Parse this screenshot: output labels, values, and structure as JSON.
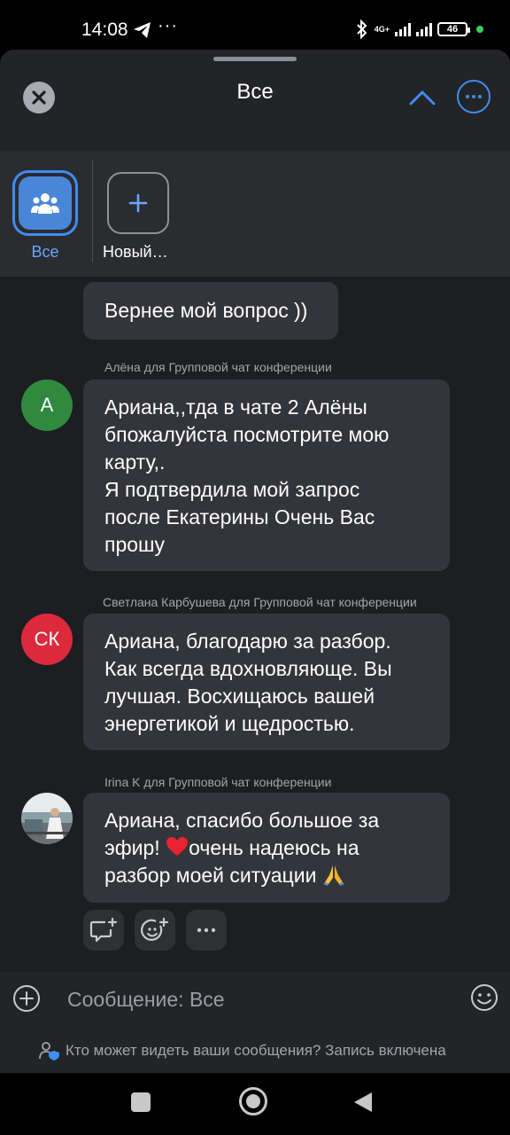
{
  "status_bar": {
    "time": "14:08",
    "dots": "···",
    "network": "4G+",
    "battery": "46"
  },
  "header": {
    "title": "Все"
  },
  "groups": [
    {
      "label": "Все"
    },
    {
      "label": "Новый…"
    }
  ],
  "messages": [
    {
      "text": "Вернее мой вопрос ))"
    },
    {
      "sender": "Алёна для Групповой чат конференции",
      "avatar_initials": "А",
      "avatar_color": "#2f8a3f",
      "lines": [
        "Ариана,,тда в чате 2 Алёны",
        "бпожалуйста посмотрите мою",
        "карту,.",
        "Я подтвердила мой запрос",
        "после Екатерины Очень Вас",
        "прошу"
      ]
    },
    {
      "sender": "Светлана Карбушева для Групповой чат конференции",
      "avatar_initials": "СК",
      "avatar_color": "#dc2a3c",
      "lines": [
        "Ариана, благодарю за разбор.",
        "Как всегда вдохновляюще. Вы",
        "лучшая. Восхищаюсь вашей",
        "энергетикой и щедростью."
      ]
    },
    {
      "sender": "Irina K для Групповой чат конференции",
      "line1": "Ариана, спасибо большое за",
      "line2_before": "эфир! ",
      "line2_after": "очень надеюсь на",
      "line3": "разбор моей ситуации "
    }
  ],
  "composer": {
    "placeholder": "Сообщение: Все",
    "privacy_note": "Кто может видеть ваши сообщения? Запись включена"
  },
  "colors": {
    "accent": "#3f8df0",
    "sheet_bg": "#1c1e22",
    "bubble_bg": "#33353a"
  }
}
